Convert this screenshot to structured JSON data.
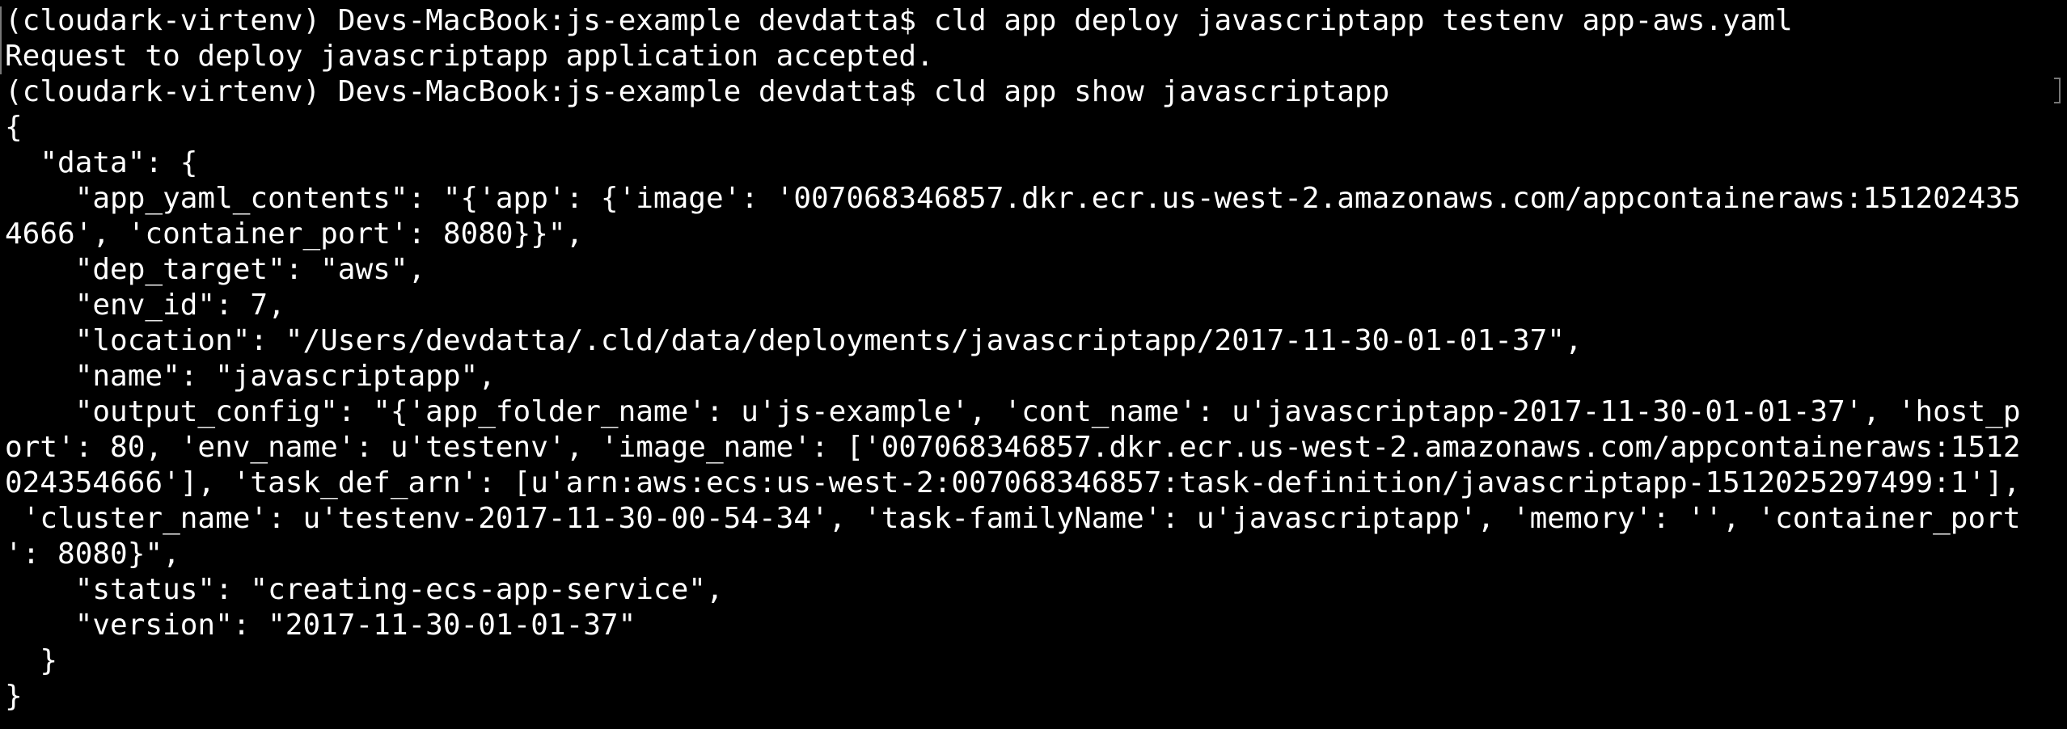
{
  "terminal": {
    "lines": [
      "(cloudark-virtenv) Devs-MacBook:js-example devdatta$ cld app deploy javascriptapp testenv app-aws.yaml",
      "Request to deploy javascriptapp application accepted.",
      "(cloudark-virtenv) Devs-MacBook:js-example devdatta$ cld app show javascriptapp",
      "{",
      "  \"data\": {",
      "    \"app_yaml_contents\": \"{'app': {'image': '007068346857.dkr.ecr.us-west-2.amazonaws.com/appcontaineraws:151202435",
      "4666', 'container_port': 8080}}\",",
      "    \"dep_target\": \"aws\",",
      "    \"env_id\": 7,",
      "    \"location\": \"/Users/devdatta/.cld/data/deployments/javascriptapp/2017-11-30-01-01-37\",",
      "    \"name\": \"javascriptapp\",",
      "    \"output_config\": \"{'app_folder_name': u'js-example', 'cont_name': u'javascriptapp-2017-11-30-01-01-37', 'host_p",
      "ort': 80, 'env_name': u'testenv', 'image_name': ['007068346857.dkr.ecr.us-west-2.amazonaws.com/appcontaineraws:1512",
      "024354666'], 'task_def_arn': [u'arn:aws:ecs:us-west-2:007068346857:task-definition/javascriptapp-1512025297499:1'],",
      " 'cluster_name': u'testenv-2017-11-30-00-54-34', 'task-familyName': u'javascriptapp', 'memory': '', 'container_port",
      "': 8080}\",",
      "    \"status\": \"creating-ecs-app-service\",",
      "    \"version\": \"2017-11-30-01-01-37\"",
      "  }",
      "}"
    ]
  }
}
